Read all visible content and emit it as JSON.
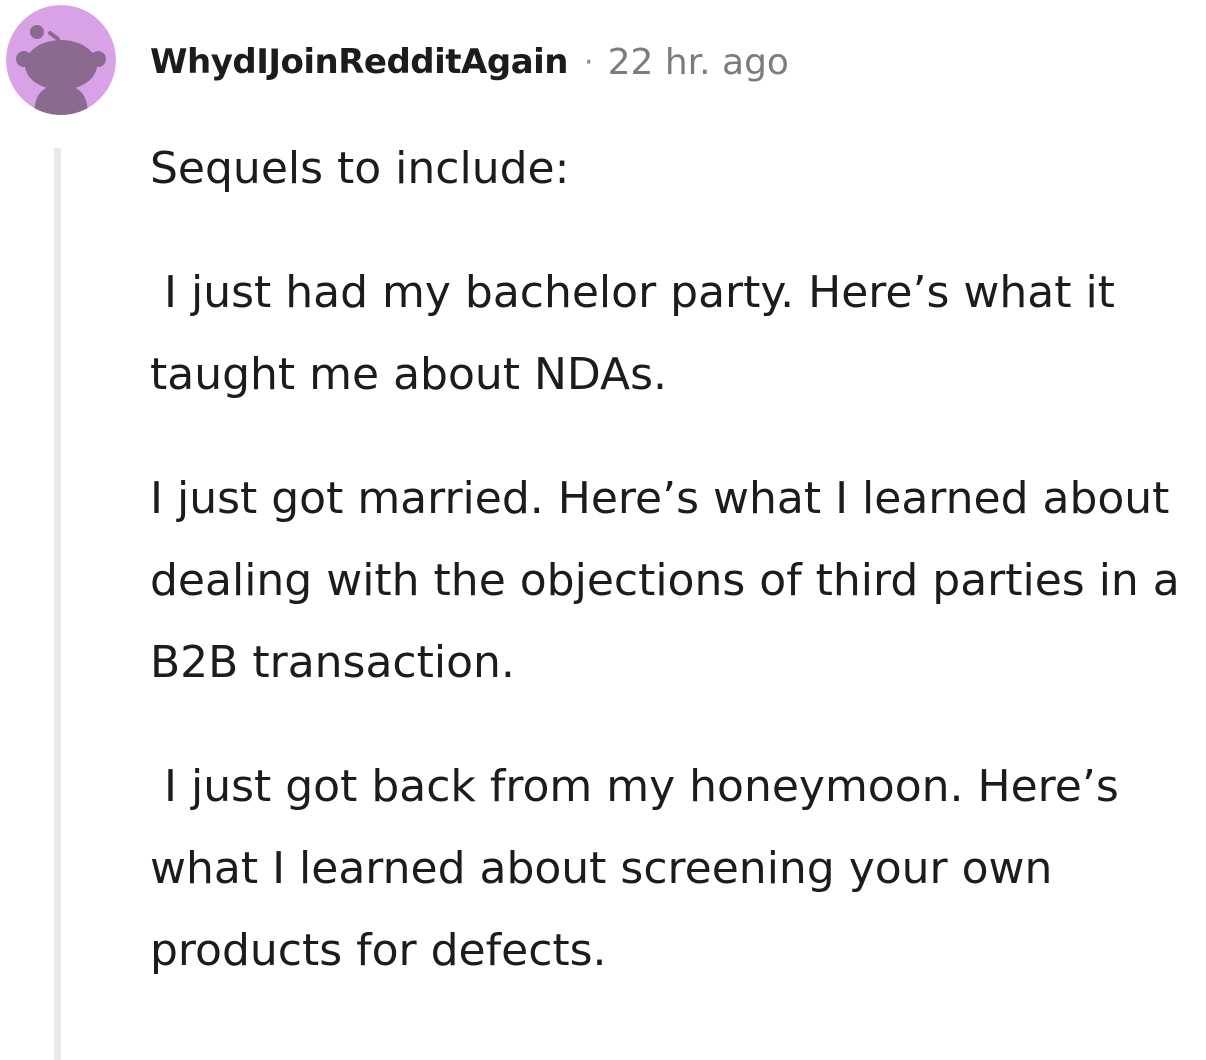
{
  "comment": {
    "author": "WhydIJoinRedditAgain",
    "separator": "·",
    "timestamp": "22 hr. ago",
    "avatar_icon": "snoo-avatar-icon",
    "avatar_color": "#d9a2e6",
    "paragraphs": [
      "Sequels to include:",
      " I just had my bachelor party. Here’s what it taught me about NDAs.",
      "I just got married. Here’s what I learned about dealing with the objections of third parties in a B2B transaction.",
      " I just got back from my honeymoon. Here’s what I learned about screening your own products for defects."
    ]
  }
}
